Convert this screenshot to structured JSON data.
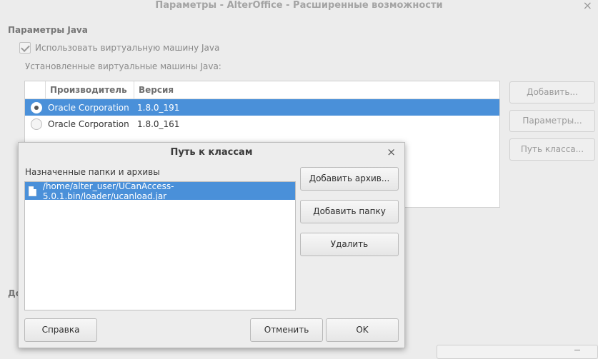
{
  "main_window": {
    "title": "Параметры - AlterOffice - Расширенные возможности",
    "close_glyph": "×",
    "section_java": "Параметры Java",
    "use_jvm_label": "Использовать виртуальную машину Java",
    "use_jvm_checked": true,
    "installed_jvm_label": "Установленные виртуальные машины Java:",
    "table": {
      "columns": [
        "Производитель",
        "Версия"
      ],
      "rows": [
        {
          "vendor": "Oracle Corporation",
          "version": "1.8.0_191",
          "selected": true
        },
        {
          "vendor": "Oracle Corporation",
          "version": "1.8.0_161",
          "selected": false
        }
      ]
    },
    "buttons": {
      "add": "Добавить...",
      "parameters": "Параметры...",
      "class_path": "Путь класса..."
    },
    "cut_label": "До"
  },
  "dialog": {
    "title": "Путь к классам",
    "close_glyph": "×",
    "list_label": "Назначенные папки и архивы",
    "entries": [
      "/home/alter_user/UCanAccess-5.0.1.bin/loader/ucanload.jar"
    ],
    "buttons": {
      "add_archive": "Добавить архив...",
      "add_folder": "Добавить папку",
      "remove": "Удалить",
      "help": "Справка",
      "cancel": "Отменить",
      "ok": "OK"
    }
  },
  "colors": {
    "selection": "#4a90d9",
    "window_bg": "#ececec"
  }
}
